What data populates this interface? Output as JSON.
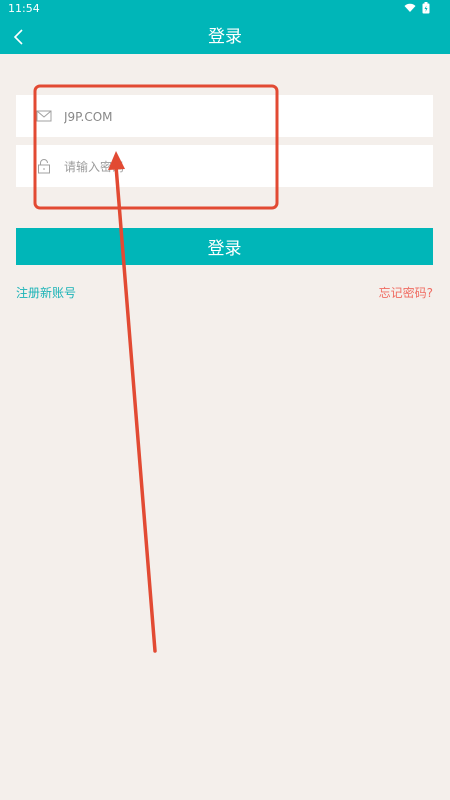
{
  "status_bar": {
    "time": "11:54",
    "icons": [
      "wifi-icon",
      "battery-icon"
    ]
  },
  "app_bar": {
    "title": "登录",
    "back_icon": "chevron-left-icon"
  },
  "form": {
    "account": {
      "value": "J9P.COM",
      "icon": "mail-icon"
    },
    "password": {
      "placeholder": "请输入密码",
      "icon": "lock-icon"
    }
  },
  "actions": {
    "login_label": "登录",
    "register_label": "注册新账号",
    "forgot_label": "忘记密码?"
  },
  "colors": {
    "primary": "#00b6b8",
    "background": "#f4efeb",
    "link_primary": "#1ab3b7",
    "link_warning": "#f06c62",
    "annotation": "#e24a33"
  }
}
